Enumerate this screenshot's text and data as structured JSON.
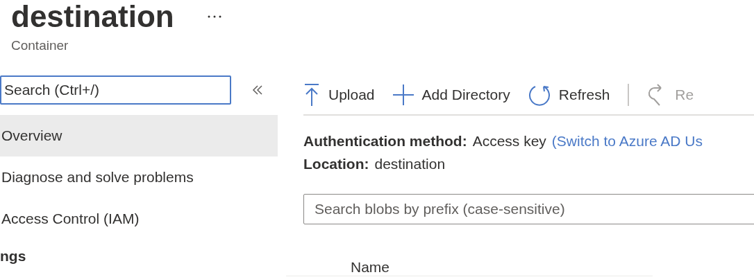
{
  "header": {
    "title": "destination",
    "subtitle": "Container"
  },
  "sidebar": {
    "search": {
      "placeholder": "Search (Ctrl+/)"
    },
    "items": [
      {
        "label": "Overview",
        "selected": true
      },
      {
        "label": "Diagnose and solve problems",
        "selected": false
      },
      {
        "label": "Access Control (IAM)",
        "selected": false
      }
    ],
    "section": "ngs"
  },
  "toolbar": [
    {
      "kind": "upload",
      "label": "Upload",
      "disabled": false
    },
    {
      "kind": "add",
      "label": "Add Directory",
      "disabled": false
    },
    {
      "kind": "refresh",
      "label": "Refresh",
      "disabled": false
    },
    {
      "kind": "redo",
      "label": "Re",
      "disabled": true
    }
  ],
  "auth": {
    "label": "Authentication method:",
    "value": "Access key",
    "link": "(Switch to Azure AD Us"
  },
  "location": {
    "label": "Location:",
    "value": "destination"
  },
  "blob_search": {
    "placeholder": "Search blobs by prefix (case-sensitive)"
  },
  "table": {
    "columns": [
      "Name"
    ]
  }
}
